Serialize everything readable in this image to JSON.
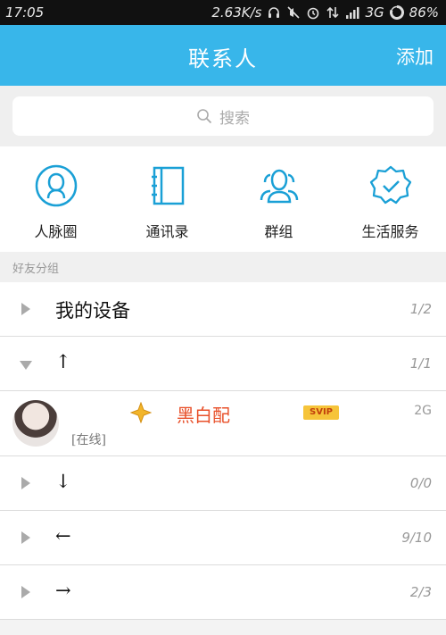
{
  "status_bar": {
    "time": "17:05",
    "speed": "2.63K/s",
    "network": "3G",
    "battery": "86%",
    "icons": [
      "headset-icon",
      "mute-icon",
      "alarm-icon",
      "data-arrows-icon",
      "signal-icon",
      "battery-icon"
    ]
  },
  "header": {
    "title": "联系人",
    "add_label": "添加",
    "color": "#38b6ea"
  },
  "search": {
    "placeholder": "搜索"
  },
  "quick_actions": [
    {
      "label": "人脉圈",
      "icon": "person-circle-icon"
    },
    {
      "label": "通讯录",
      "icon": "address-book-icon"
    },
    {
      "label": "群组",
      "icon": "group-icon"
    },
    {
      "label": "生活服务",
      "icon": "verified-badge-icon"
    }
  ],
  "group_label": "好友分组",
  "groups": [
    {
      "name": "我的设备",
      "count": "1/2",
      "expanded": false
    },
    {
      "name": "↑",
      "count": "1/1",
      "expanded": true
    },
    {
      "name": "↓",
      "count": "0/0",
      "expanded": false
    },
    {
      "name": "←",
      "count": "9/10",
      "expanded": false
    },
    {
      "name": "→",
      "count": "2/3",
      "expanded": false
    }
  ],
  "contact": {
    "name": "黑白配",
    "badge": "SVIP",
    "network": "2G",
    "status": "[在线]"
  }
}
